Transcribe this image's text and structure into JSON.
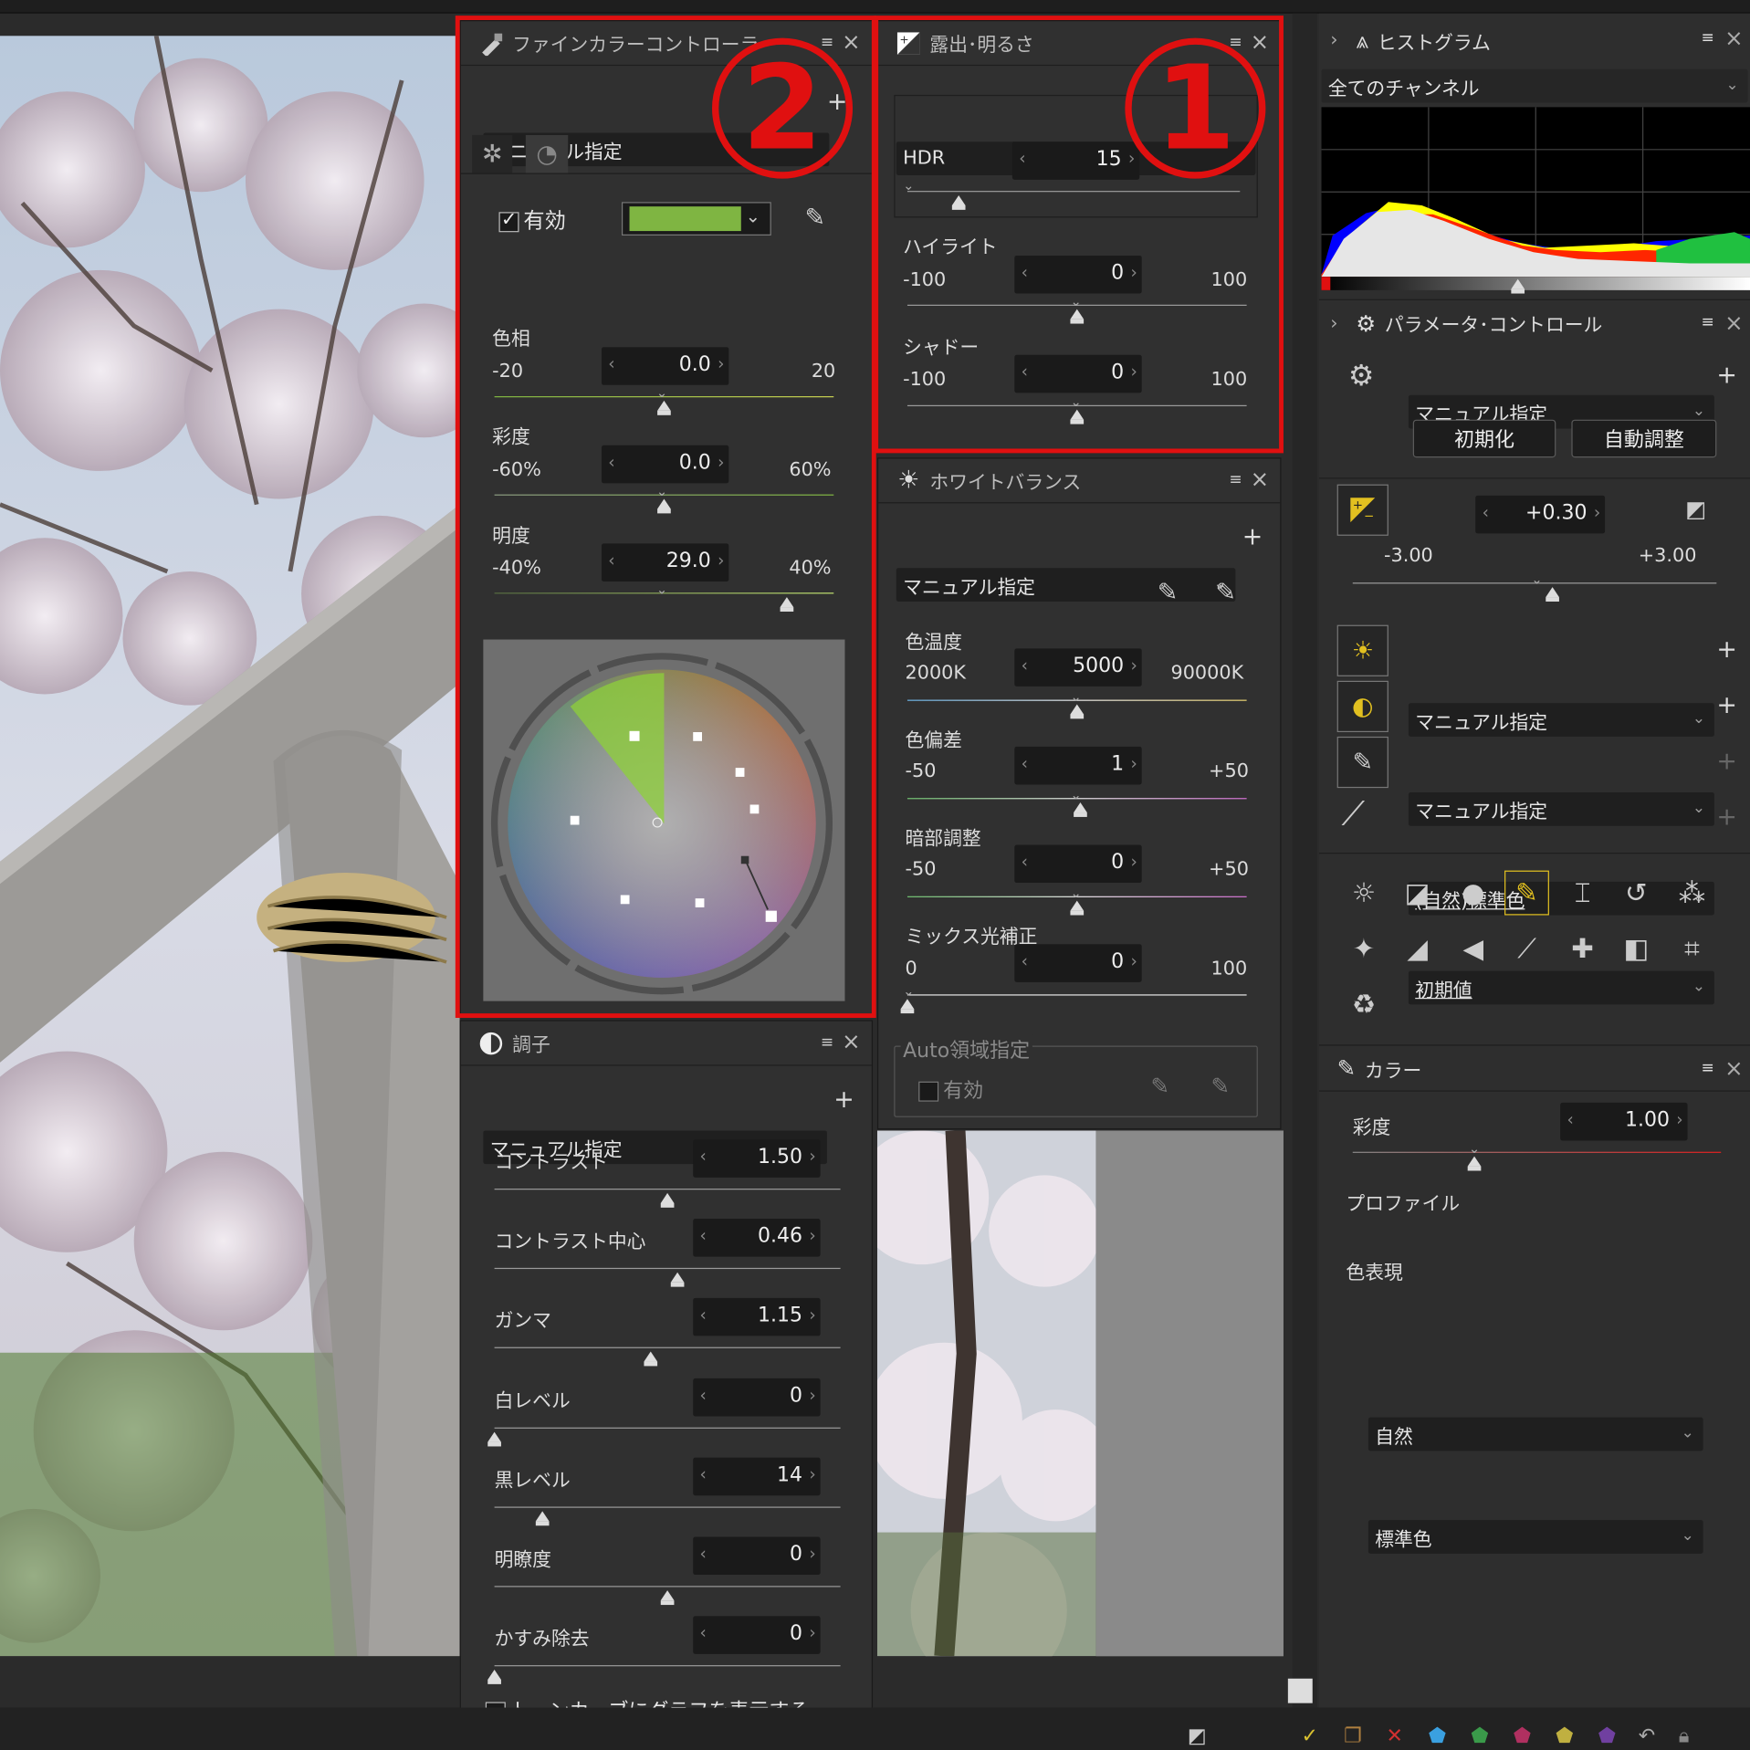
{
  "annotations": {
    "box1_label": "1",
    "box2_label": "2"
  },
  "fine_color": {
    "title": "ファインカラーコントローラ",
    "preset": "マニュアル指定",
    "enabled_label": "有効",
    "swatch_color": "#7fb542",
    "hue": {
      "label": "色相",
      "min": "-20",
      "max": "20",
      "value": "0.0",
      "fraction": 0.5
    },
    "saturation": {
      "label": "彩度",
      "min": "-60%",
      "max": "60%",
      "value": "0.0",
      "fraction": 0.5
    },
    "brightness": {
      "label": "明度",
      "min": "-40%",
      "max": "40%",
      "value": "29.0",
      "fraction": 0.8625
    }
  },
  "exposure": {
    "title": "露出･明るさ",
    "mode": "HDR",
    "hdr_value": "15",
    "highlight": {
      "label": "ハイライト",
      "min": "-100",
      "max": "100",
      "value": "0",
      "fraction": 0.5
    },
    "shadow": {
      "label": "シャドー",
      "min": "-100",
      "max": "100",
      "value": "0",
      "fraction": 0.5
    }
  },
  "white_balance": {
    "title": "ホワイトバランス",
    "preset": "マニュアル指定",
    "temperature": {
      "label": "色温度",
      "min": "2000K",
      "max": "90000K",
      "value": "5000",
      "fraction": 0.5
    },
    "tint": {
      "label": "色偏差",
      "min": "-50",
      "max": "+50",
      "value": "1",
      "fraction": 0.51
    },
    "shade": {
      "label": "暗部調整",
      "min": "-50",
      "max": "+50",
      "value": "0",
      "fraction": 0.5
    },
    "mixed_light": {
      "label": "ミックス光補正",
      "min": "0",
      "max": "100",
      "value": "0",
      "fraction": 0.0
    },
    "auto_region_title": "Auto領域指定",
    "auto_enabled_label": "有効"
  },
  "tone": {
    "title": "調子",
    "preset": "マニュアル指定",
    "rows": [
      {
        "label": "コントラスト",
        "value": "1.50",
        "fraction": 0.5
      },
      {
        "label": "コントラスト中心",
        "value": "0.46",
        "fraction": 0.53
      },
      {
        "label": "ガンマ",
        "value": "1.15",
        "fraction": 0.45
      },
      {
        "label": "白レベル",
        "value": "0",
        "fraction": 0.0
      },
      {
        "label": "黒レベル",
        "value": "14",
        "fraction": 0.14
      },
      {
        "label": "明瞭度",
        "value": "0",
        "fraction": 0.5
      },
      {
        "label": "かすみ除去",
        "value": "0",
        "fraction": 0.0
      }
    ],
    "show_graph_label": "トーンカーブにグラフを表示する"
  },
  "histogram": {
    "title": "ヒストグラム",
    "channel": "全てのチャンネル"
  },
  "param_control": {
    "title": "パラメータ･コントロール",
    "preset": "マニュアル指定",
    "reset_button": "初期化",
    "auto_button": "自動調整",
    "exposure_value": "+0.30",
    "exposure_min": "-3.00",
    "exposure_max": "+3.00",
    "exposure_fraction": 0.55,
    "wb_preset": "マニュアル指定",
    "tone_preset": "マニュアル指定",
    "picture_preset": "(自然)標準色",
    "retouch_preset": "初期値"
  },
  "color_panel": {
    "title": "カラー",
    "saturation_label": "彩度",
    "saturation_value": "1.00",
    "saturation_fraction": 0.33,
    "profile_label": "プロファイル",
    "profile_value": "自然",
    "render_label": "色表現",
    "render_value": "標準色"
  },
  "icons": {
    "menu": "≡",
    "close": "×",
    "plus": "+",
    "chevron": "⌄",
    "left": "‹",
    "right": "›"
  },
  "colors": {
    "accent_red": "#e01010",
    "highlight_yellow": "#e2c020"
  }
}
